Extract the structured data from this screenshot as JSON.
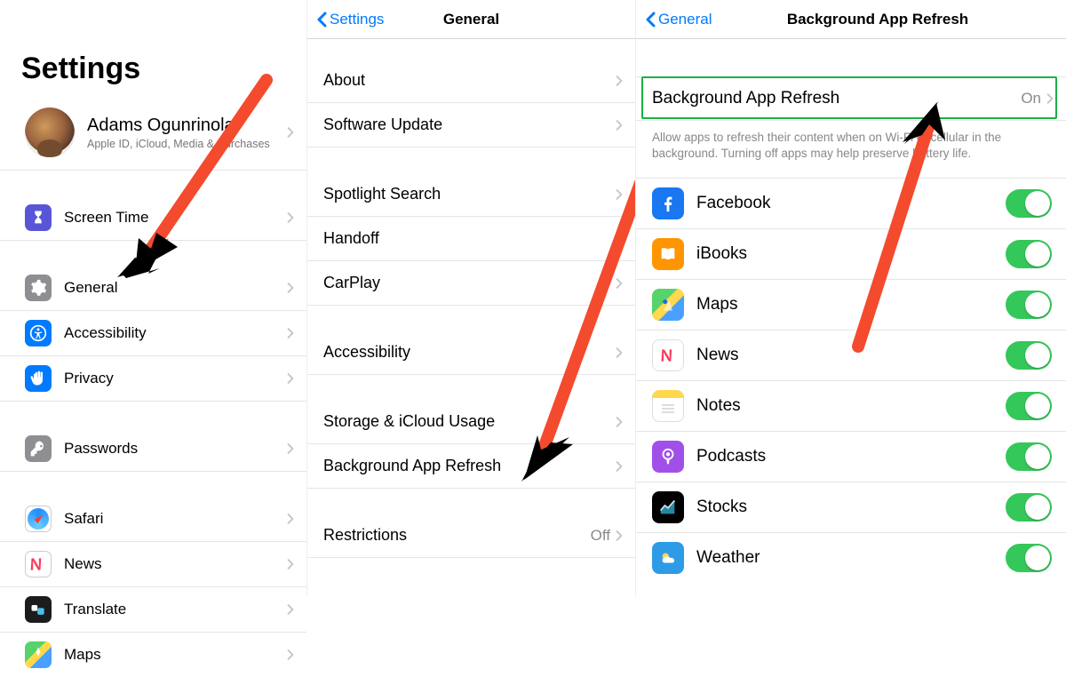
{
  "col1": {
    "title": "Settings",
    "profile": {
      "name": "Adams Ogunrinola",
      "sub": "Apple ID, iCloud, Media & Purchases"
    },
    "items_a": [
      {
        "key": "screen-time",
        "label": "Screen Time",
        "icon": "hourglass"
      }
    ],
    "items_b": [
      {
        "key": "general",
        "label": "General",
        "icon": "gear"
      },
      {
        "key": "accessibility",
        "label": "Accessibility",
        "icon": "access"
      },
      {
        "key": "privacy",
        "label": "Privacy",
        "icon": "privacy"
      }
    ],
    "items_c": [
      {
        "key": "passwords",
        "label": "Passwords",
        "icon": "pass"
      }
    ],
    "items_d": [
      {
        "key": "safari",
        "label": "Safari",
        "icon": "safari"
      },
      {
        "key": "news",
        "label": "News",
        "icon": "news"
      },
      {
        "key": "translate",
        "label": "Translate",
        "icon": "translate"
      },
      {
        "key": "maps",
        "label": "Maps",
        "icon": "maps"
      }
    ]
  },
  "col2": {
    "back": "Settings",
    "title": "General",
    "groups": [
      [
        {
          "key": "about",
          "label": "About"
        },
        {
          "key": "software-update",
          "label": "Software Update"
        }
      ],
      [
        {
          "key": "spotlight",
          "label": "Spotlight Search"
        },
        {
          "key": "handoff",
          "label": "Handoff"
        },
        {
          "key": "carplay",
          "label": "CarPlay"
        }
      ],
      [
        {
          "key": "accessibility",
          "label": "Accessibility"
        }
      ],
      [
        {
          "key": "storage",
          "label": "Storage & iCloud Usage"
        },
        {
          "key": "bg-refresh",
          "label": "Background App Refresh"
        }
      ],
      [
        {
          "key": "restrictions",
          "label": "Restrictions",
          "value": "Off"
        }
      ]
    ]
  },
  "col3": {
    "back": "General",
    "title": "Background App Refresh",
    "master": {
      "label": "Background App Refresh",
      "value": "On"
    },
    "desc": "Allow apps to refresh their content when on Wi-Fi or cellular in the background. Turning off apps may help preserve battery life.",
    "apps": [
      {
        "key": "facebook",
        "label": "Facebook",
        "icon": "facebook",
        "on": true
      },
      {
        "key": "ibooks",
        "label": "iBooks",
        "icon": "ibooks",
        "on": true
      },
      {
        "key": "maps",
        "label": "Maps",
        "icon": "maps2",
        "on": true
      },
      {
        "key": "news",
        "label": "News",
        "icon": "news2",
        "on": true
      },
      {
        "key": "notes",
        "label": "Notes",
        "icon": "notes",
        "on": true
      },
      {
        "key": "podcasts",
        "label": "Podcasts",
        "icon": "podcasts",
        "on": true
      },
      {
        "key": "stocks",
        "label": "Stocks",
        "icon": "stocks",
        "on": true
      },
      {
        "key": "weather",
        "label": "Weather",
        "icon": "weather",
        "on": true
      }
    ]
  }
}
